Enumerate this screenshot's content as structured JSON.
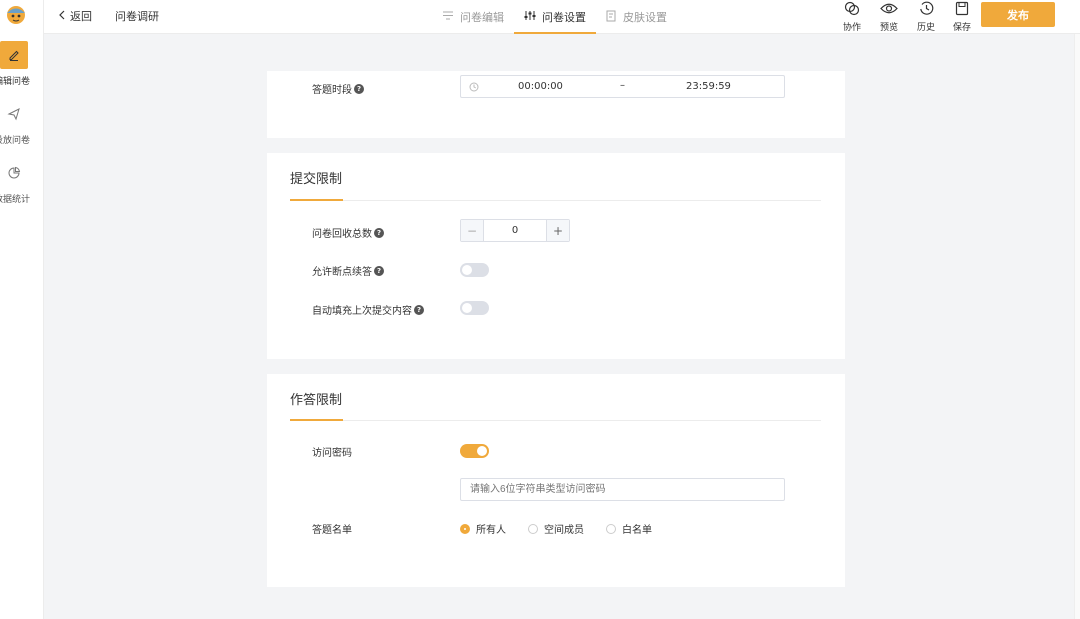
{
  "sidebar": {
    "items": [
      {
        "label": "编辑问卷",
        "icon": "pencil-icon",
        "active": true
      },
      {
        "label": "投放问卷",
        "icon": "send-icon",
        "active": false
      },
      {
        "label": "数据统计",
        "icon": "pie-chart-icon",
        "active": false
      }
    ]
  },
  "header": {
    "back_label": "返回",
    "title": "问卷调研",
    "tabs": [
      {
        "label": "问卷编辑",
        "icon": "edit-list-icon"
      },
      {
        "label": "问卷设置",
        "icon": "sliders-icon",
        "active": true
      },
      {
        "label": "皮肤设置",
        "icon": "skin-icon"
      }
    ],
    "tools": [
      {
        "label": "协作",
        "icon": "link-icon"
      },
      {
        "label": "预览",
        "icon": "eye-icon"
      },
      {
        "label": "历史",
        "icon": "history-icon"
      },
      {
        "label": "保存",
        "icon": "save-icon"
      }
    ],
    "publish_label": "发布"
  },
  "time_card": {
    "label": "答题时段",
    "start": "00:00:00",
    "separator": "–",
    "end": "23:59:59"
  },
  "submit_card": {
    "title": "提交限制",
    "total_label": "问卷回收总数",
    "total_value": "0",
    "minus": "−",
    "plus": "+",
    "resume_label": "允许断点续答",
    "resume_on": false,
    "autofill_label": "自动填充上次提交内容",
    "autofill_on": false
  },
  "answer_card": {
    "title": "作答限制",
    "password_label": "访问密码",
    "password_on": true,
    "password_placeholder": "请输入6位字符串类型访问密码",
    "list_label": "答题名单",
    "list_options": [
      "所有人",
      "空间成员",
      "白名单"
    ],
    "list_selected": "所有人"
  },
  "colors": {
    "accent": "#f0a93b",
    "background": "#f3f4f6"
  }
}
